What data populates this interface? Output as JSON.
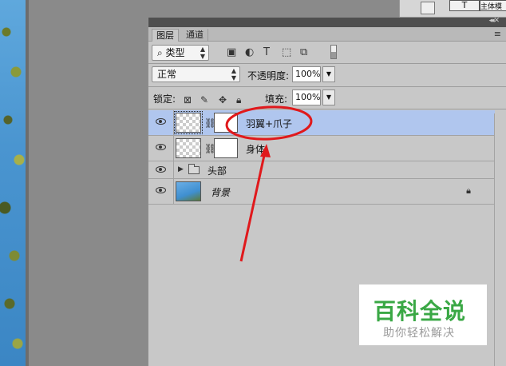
{
  "top_panel": {
    "box1": "T",
    "box2": "主体模"
  },
  "panel": {
    "tabs": [
      {
        "label": "图层"
      },
      {
        "label": "通道"
      }
    ],
    "filter": {
      "label": "类型"
    },
    "blend": {
      "mode": "正常",
      "opacity_label": "不透明度:",
      "opacity_value": "100%"
    },
    "lock": {
      "label": "锁定:",
      "fill_label": "填充:",
      "fill_value": "100%"
    },
    "layers": [
      {
        "name": "羽翼+爪子",
        "selected": true
      },
      {
        "name": "身体",
        "selected": false
      },
      {
        "name": "头部",
        "type": "group"
      },
      {
        "name": "背景",
        "locked": true
      }
    ]
  },
  "annotation": {
    "color": "#e0191c"
  },
  "watermark": {
    "title": "百科全说",
    "subtitle": "助你轻松解决",
    "color": "#3aa845"
  }
}
